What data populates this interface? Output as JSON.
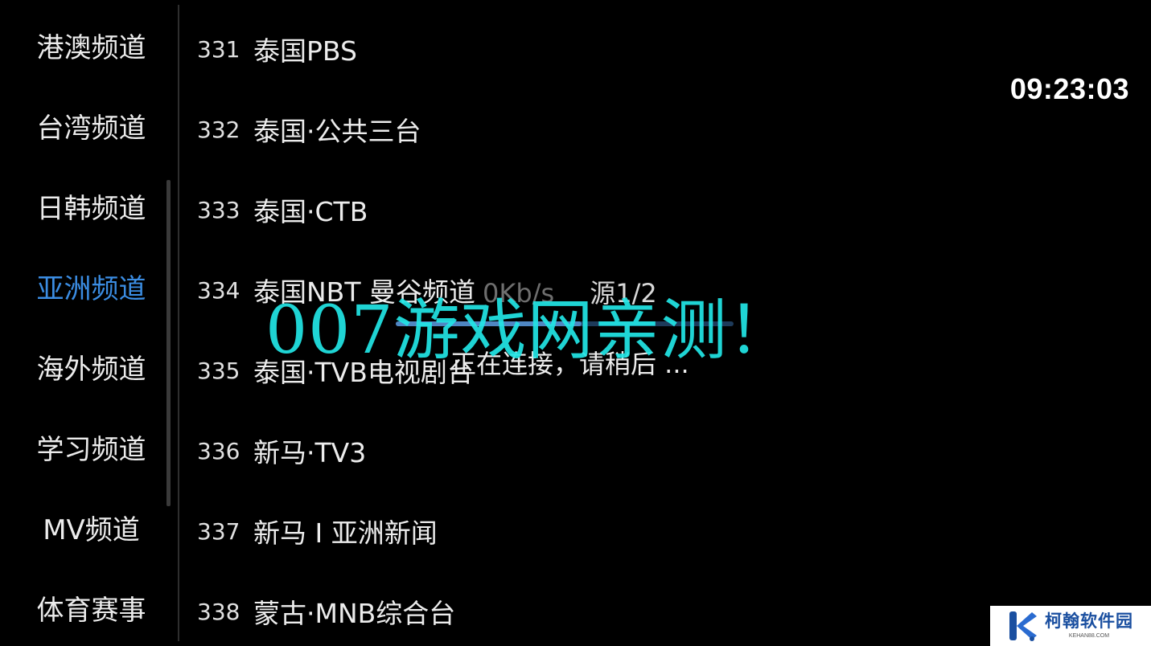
{
  "clock": "09:23:03",
  "categories": [
    {
      "label": "港澳频道",
      "active": false
    },
    {
      "label": "台湾频道",
      "active": false
    },
    {
      "label": "日韩频道",
      "active": false
    },
    {
      "label": "亚洲频道",
      "active": true
    },
    {
      "label": "海外频道",
      "active": false
    },
    {
      "label": "学习频道",
      "active": false
    },
    {
      "label": "MV频道",
      "active": false
    },
    {
      "label": "体育赛事",
      "active": false
    }
  ],
  "channels": [
    {
      "number": "331",
      "name": "泰国PBS"
    },
    {
      "number": "332",
      "name": "泰国·公共三台"
    },
    {
      "number": "333",
      "name": "泰国·CTB"
    },
    {
      "number": "334",
      "name": "泰国NBT 曼谷频道"
    },
    {
      "number": "335",
      "name": "泰国·TVB电视剧台"
    },
    {
      "number": "336",
      "name": "新马·TV3"
    },
    {
      "number": "337",
      "name": "新马 I 亚洲新闻"
    },
    {
      "number": "338",
      "name": "蒙古·MNB综合台"
    }
  ],
  "loading": {
    "speed": "0Kb/s",
    "source": "源1/2",
    "progress": 0.55,
    "status": "正在连接，请稍后 ..."
  },
  "watermark": "007游戏网亲测！",
  "logo": {
    "name": "柯翰软件园",
    "domain": "KEHAN88.COM"
  },
  "colors": {
    "active_category": "#3b8de3",
    "watermark": "#22e6e6",
    "logo_brand": "#1a4fa0"
  }
}
